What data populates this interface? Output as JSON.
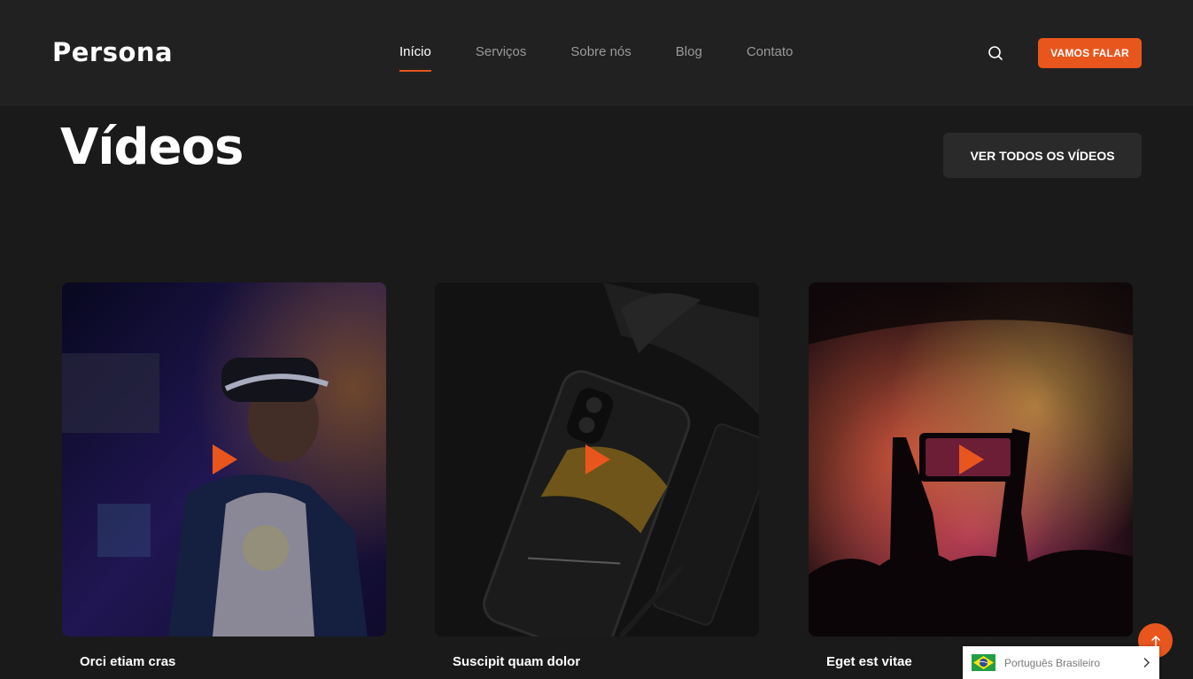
{
  "brand": {
    "logo": "Persona",
    "accent": "#e8561e"
  },
  "nav": {
    "items": [
      {
        "label": "Início",
        "active": true
      },
      {
        "label": "Serviços",
        "active": false
      },
      {
        "label": "Sobre nós",
        "active": false
      },
      {
        "label": "Blog",
        "active": false
      },
      {
        "label": "Contato",
        "active": false
      }
    ],
    "search_icon": "search-icon",
    "cta_label": "VAMOS FALAR"
  },
  "videos_section": {
    "title": "Vídeos",
    "see_all_label": "VER TODOS OS VÍDEOS",
    "cards": [
      {
        "title": "Orci etiam cras",
        "thumbnail": "vr-headset-person",
        "icon": "play-icon"
      },
      {
        "title": "Suscipit quam dolor",
        "thumbnail": "smartphone-dark",
        "icon": "play-icon"
      },
      {
        "title": "Eget est vitae",
        "thumbnail": "concert-phone",
        "icon": "play-icon"
      }
    ]
  },
  "scroll_top": {
    "icon": "arrow-up-icon"
  },
  "language": {
    "label": "Português Brasileiro",
    "flag_icon": "brazil-flag-icon",
    "chevron_icon": "chevron-right-icon"
  }
}
